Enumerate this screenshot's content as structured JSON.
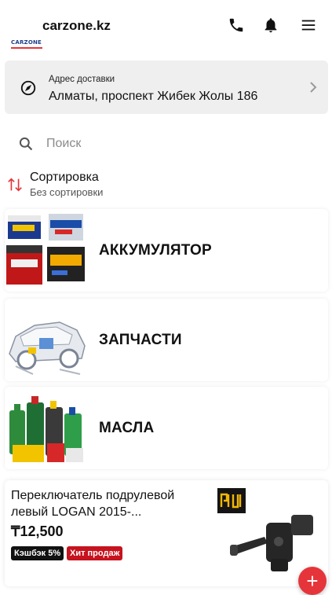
{
  "header": {
    "logo_text": "CARZONE",
    "site_name": "carzone.kz",
    "icons": [
      "phone-icon",
      "bell-icon",
      "menu-icon"
    ]
  },
  "delivery": {
    "caption": "Адрес доставки",
    "address": "Алматы, проспект Жибек Жолы 186"
  },
  "search": {
    "placeholder": "Поиск",
    "value": ""
  },
  "sort": {
    "title": "Сортировка",
    "value": "Без сортировки"
  },
  "categories": [
    {
      "label": "АККУМУЛЯТОР"
    },
    {
      "label": "ЗАПЧАСТИ"
    },
    {
      "label": "МАСЛА"
    }
  ],
  "product": {
    "title": "Переключатель подрулевой левый LOGAN 2015-...",
    "price": "₸12,500",
    "badges": [
      "Кэшбэк 5%",
      "Хит продаж"
    ]
  },
  "colors": {
    "accent": "#e5353a",
    "hit_badge": "#c6131e",
    "card_bg": "#efefef"
  }
}
